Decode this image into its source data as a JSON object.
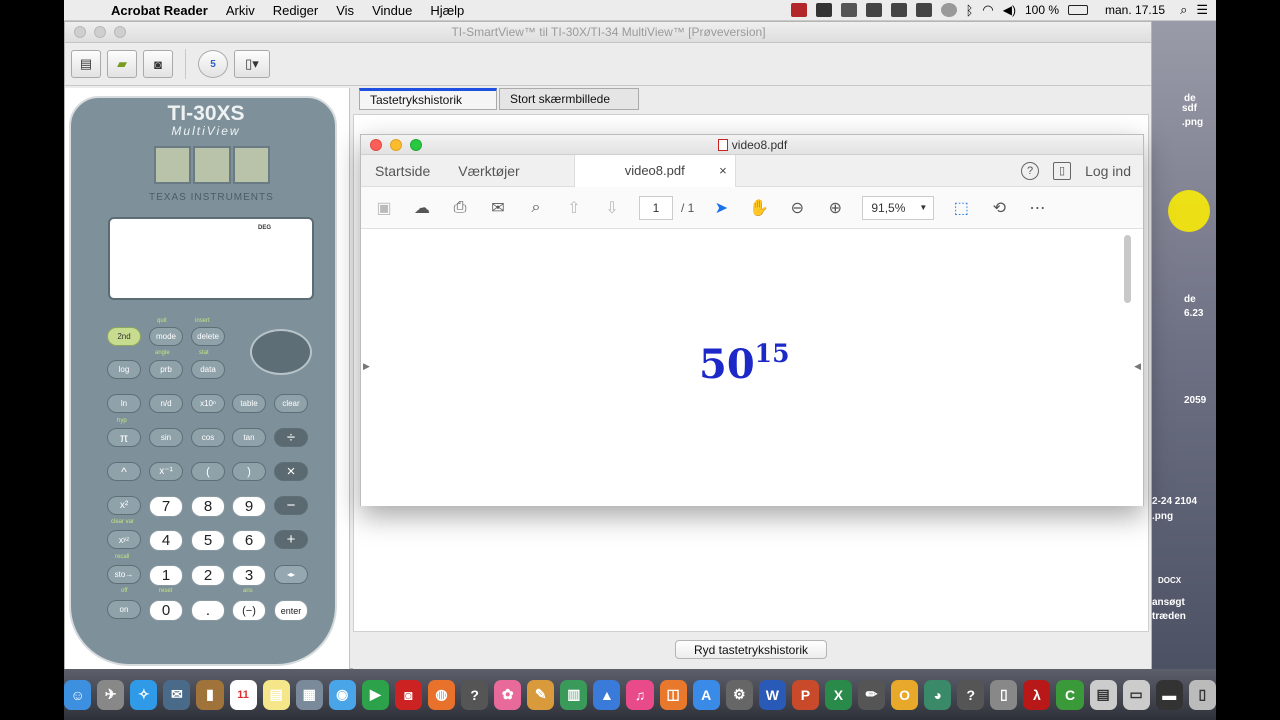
{
  "menubar": {
    "apple": "",
    "app": "Acrobat Reader",
    "menus": [
      "Arkiv",
      "Rediger",
      "Vis",
      "Vindue",
      "Hjælp"
    ],
    "battery": "100 %",
    "clock": "man. 17.15"
  },
  "window": {
    "title": "TI-SmartView™ til TI-30X/TI-34 MultiView™ [Prøveversion]",
    "toolbar_badge": "5"
  },
  "calculator": {
    "model": "TI-30XS",
    "sub": "MultiView",
    "brand": "TEXAS INSTRUMENTS",
    "lcd_indicator": "DEG",
    "keys": {
      "second": "2nd",
      "mode": "mode",
      "delete": "delete",
      "log": "log",
      "prb": "prb",
      "data": "data",
      "ln": "ln",
      "frac": "n/d",
      "x10n": "x10ⁿ",
      "table": "table",
      "clear": "clear",
      "pi": "π",
      "sin": "sin",
      "cos": "cos",
      "tan": "tan",
      "div": "÷",
      "pow": "^",
      "inv": "x⁻¹",
      "lpar": "(",
      "rpar": ")",
      "mul": "×",
      "sq": "x²",
      "n7": "7",
      "n8": "8",
      "n9": "9",
      "minus": "−",
      "xyz": "xʸᶻ",
      "n4": "4",
      "n5": "5",
      "n6": "6",
      "plus": "+",
      "sto": "sto→",
      "n1": "1",
      "n2": "2",
      "n3": "3",
      "toggle": "◂▸",
      "on": "on",
      "n0": "0",
      "dot": ".",
      "neg": "(−)",
      "enter": "enter"
    },
    "labels": {
      "quit": "quit",
      "insert": "insert",
      "angle": "angle",
      "stat": "stat",
      "hyp": "hyp",
      "clearvar": "clear var",
      "recall": "recall",
      "off": "off",
      "reset": "reset",
      "ans": "ans"
    }
  },
  "tabs": {
    "history": "Tastetrykshistorik",
    "screen": "Stort skærmbillede"
  },
  "clear_button": "Ryd tastetrykshistorik",
  "pdf": {
    "window_title": "video8.pdf",
    "nav": {
      "home": "Startside",
      "tools": "Værktøjer"
    },
    "doc_tab": "video8.pdf",
    "doc_tab_close": "×",
    "help": "?",
    "login": "Log ind",
    "page": "1",
    "page_total": "/ 1",
    "zoom": "91,5%",
    "content": {
      "base": "50",
      "exponent": "15"
    }
  },
  "desktop": {
    "labels": [
      "de",
      "sdf",
      ".png",
      "de",
      "6.23",
      "2059",
      "2-24 2104",
      ".png",
      "DOCX",
      "ansøgt",
      "træden"
    ]
  },
  "dock": {
    "calendar_day": "11"
  }
}
